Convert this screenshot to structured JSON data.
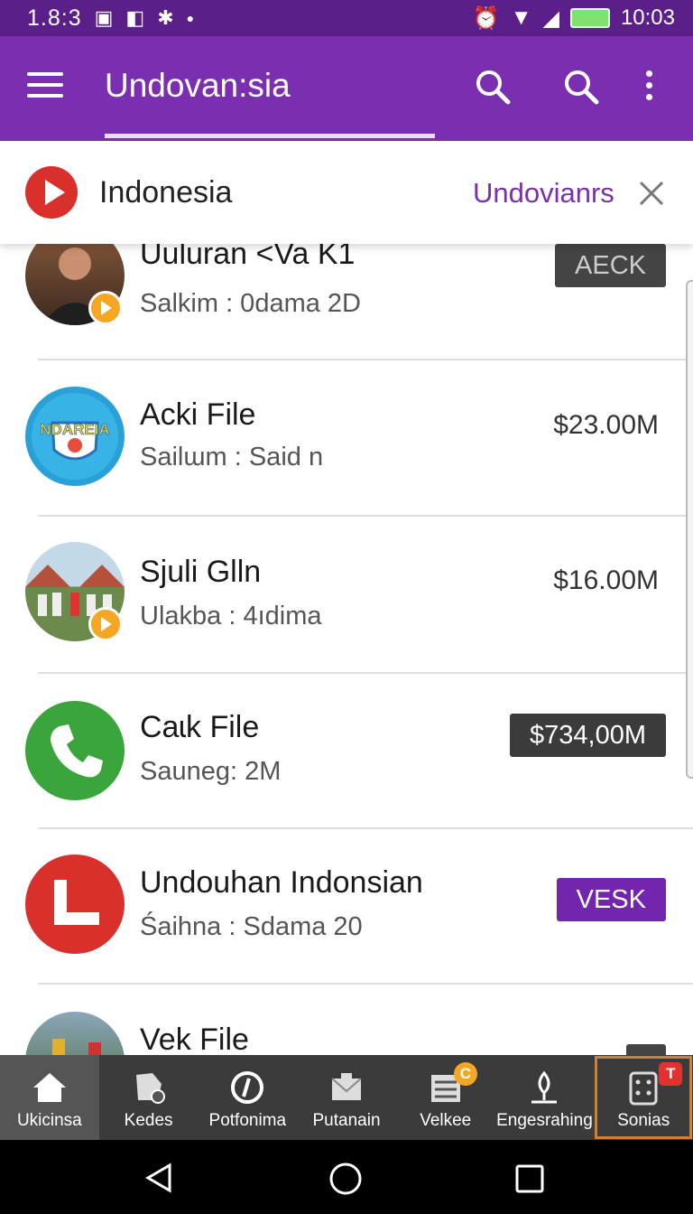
{
  "status_bar": {
    "left_time": "1.8:3",
    "clock": "10:03"
  },
  "app_bar": {
    "title": "Undovan:sia"
  },
  "banner": {
    "country": "Indonesia",
    "link": "Undovianrs"
  },
  "items": [
    {
      "title": "Uuluran <Va K1",
      "subtitle": "Salkim : 0dama 2D",
      "tag": "AECK",
      "tag_style": "dark"
    },
    {
      "title": "Acki File",
      "subtitle": "Sailɯm : Said n",
      "price": "$23.00M",
      "avatar_text": "NDAREIA"
    },
    {
      "title": "Sjuli Glln",
      "subtitle": "Ulakba : 4ıdima",
      "price": "$16.00M"
    },
    {
      "title": "Caɩk File",
      "subtitle": "Sauneg: 2M",
      "tag": "$734,00M",
      "tag_style": "dark"
    },
    {
      "title": "Undouhan Indonsian",
      "subtitle": "Śaihna : Sdama 20",
      "tag": "VESK",
      "tag_style": "purple"
    },
    {
      "title": "Vek File"
    }
  ],
  "bottom_nav": [
    {
      "label": "Ukicinsa",
      "icon": "home-icon"
    },
    {
      "label": "Kedes",
      "icon": "document-check-icon"
    },
    {
      "label": "Potfonima",
      "icon": "compass-icon"
    },
    {
      "label": "Putanain",
      "icon": "envelope-icon"
    },
    {
      "label": "Velkee",
      "icon": "list-icon",
      "badge": "C"
    },
    {
      "label": "Engesrahing",
      "icon": "pin-icon"
    },
    {
      "label": "Sonias",
      "icon": "dice-icon",
      "badge": "T"
    }
  ],
  "colors": {
    "primary": "#7a2fb0",
    "status_bar": "#5b1f8a",
    "accent": "#d9302c",
    "nav_bg": "#3b3b3b"
  }
}
